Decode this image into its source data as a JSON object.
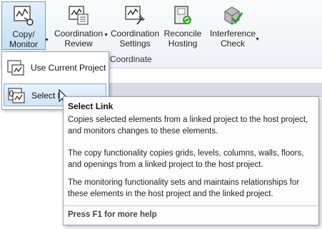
{
  "ribbon": {
    "tools": [
      {
        "label": "Copy/\nMonitor",
        "icon": "copy-monitor-icon",
        "dropdown": true,
        "active": true
      },
      {
        "label": "Coordination\nReview",
        "icon": "coordination-review-icon",
        "dropdown": true
      },
      {
        "label": "Coordination\nSettings",
        "icon": "coordination-settings-icon",
        "dropdown": false
      },
      {
        "label": "Reconcile\nHosting",
        "icon": "reconcile-hosting-icon",
        "dropdown": false
      },
      {
        "label": "Interference\nCheck",
        "icon": "interference-check-icon",
        "dropdown": true
      }
    ],
    "panel_title": "Coordinate"
  },
  "menu": {
    "items": [
      {
        "label": "Use Current Project",
        "icon": "use-current-project-icon"
      },
      {
        "label": "Select L",
        "icon": "select-link-icon"
      }
    ]
  },
  "tooltip": {
    "title": "Select Link",
    "p1": "Copies selected elements from a linked project to the host project, and monitors changes to these elements.",
    "p2": "The copy functionality copies grids, levels, columns, walls, floors, and openings from a linked project to the host project.",
    "p3": "The monitoring functionality sets and maintains relationships for these elements in the host project and the linked project.",
    "help": "Press F1 for more help"
  }
}
